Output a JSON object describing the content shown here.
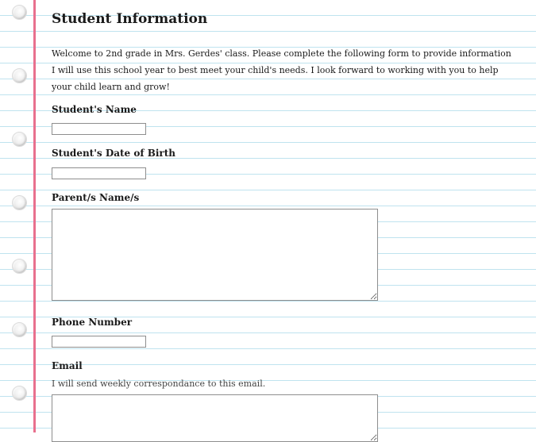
{
  "form": {
    "title": "Student Information",
    "intro": "Welcome to 2nd grade in Mrs. Gerdes' class. Please complete the following form to provide information I will use this school year to best meet your child's needs. I look forward to working with you to help your child learn and grow!",
    "fields": {
      "student_name": {
        "label": "Student's Name",
        "value": ""
      },
      "student_dob": {
        "label": "Student's Date of Birth",
        "value": ""
      },
      "parents_names": {
        "label": "Parent/s Name/s",
        "value": ""
      },
      "phone_number": {
        "label": "Phone Number",
        "value": ""
      },
      "email": {
        "label": "Email",
        "hint": "I will send weekly correspondance to this email.",
        "value": ""
      }
    }
  },
  "theme": {
    "paper_rule_color": "#bfe3ef",
    "margin_line_color": "#e8708e",
    "background": "#ffffff"
  },
  "decor": {
    "binder_hole_icon": "binder-hole-icon"
  }
}
